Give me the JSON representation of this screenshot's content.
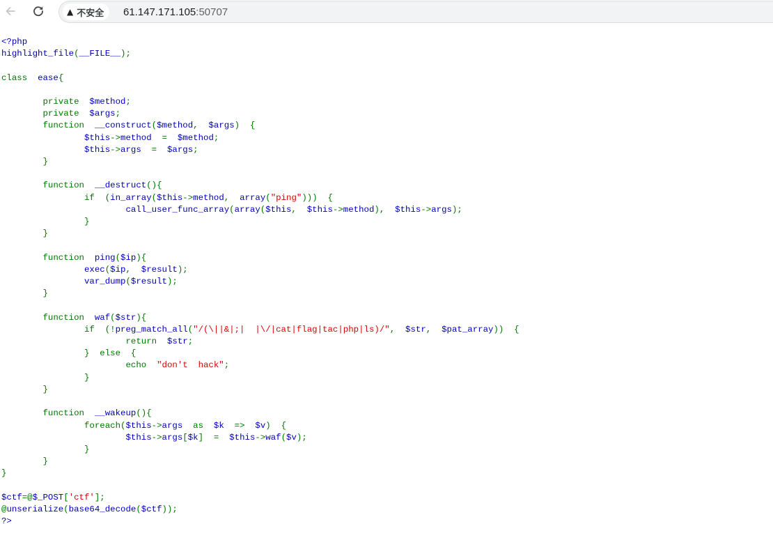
{
  "toolbar": {
    "security_label": "不安全",
    "url_host": "61.147.171.105",
    "url_port": ":50707"
  },
  "source_lines": [
    [
      [
        "d",
        "<?php"
      ]
    ],
    [
      [
        "d",
        "highlight_file"
      ],
      [
        "k",
        "("
      ],
      [
        "d",
        "__FILE__"
      ],
      [
        "k",
        ");"
      ]
    ],
    [],
    [
      [
        "k",
        "class  "
      ],
      [
        "d",
        "ease"
      ],
      [
        "k",
        "{"
      ]
    ],
    [],
    [
      [
        "k",
        "        private  "
      ],
      [
        "d",
        "$method"
      ],
      [
        "k",
        ";"
      ]
    ],
    [
      [
        "k",
        "        private  "
      ],
      [
        "d",
        "$args"
      ],
      [
        "k",
        ";"
      ]
    ],
    [
      [
        "k",
        "        function  "
      ],
      [
        "d",
        "__construct"
      ],
      [
        "k",
        "("
      ],
      [
        "d",
        "$method"
      ],
      [
        "k",
        ",  "
      ],
      [
        "d",
        "$args"
      ],
      [
        "k",
        ")  {"
      ]
    ],
    [
      [
        "d",
        "                $this"
      ],
      [
        "k",
        "->"
      ],
      [
        "d",
        "method  "
      ],
      [
        "k",
        "=  "
      ],
      [
        "d",
        "$method"
      ],
      [
        "k",
        ";"
      ]
    ],
    [
      [
        "d",
        "                $this"
      ],
      [
        "k",
        "->"
      ],
      [
        "d",
        "args  "
      ],
      [
        "k",
        "=  "
      ],
      [
        "d",
        "$args"
      ],
      [
        "k",
        ";"
      ]
    ],
    [
      [
        "k",
        "        }"
      ]
    ],
    [],
    [
      [
        "k",
        "        function  "
      ],
      [
        "d",
        "__destruct"
      ],
      [
        "k",
        "(){"
      ]
    ],
    [
      [
        "k",
        "                if  ("
      ],
      [
        "d",
        "in_array"
      ],
      [
        "k",
        "("
      ],
      [
        "d",
        "$this"
      ],
      [
        "k",
        "->"
      ],
      [
        "d",
        "method"
      ],
      [
        "k",
        ",  "
      ],
      [
        "d",
        "array"
      ],
      [
        "k",
        "("
      ],
      [
        "s",
        "\"ping\""
      ],
      [
        "k",
        ")))  {"
      ]
    ],
    [
      [
        "d",
        "                        call_user_func_array"
      ],
      [
        "k",
        "("
      ],
      [
        "d",
        "array"
      ],
      [
        "k",
        "("
      ],
      [
        "d",
        "$this"
      ],
      [
        "k",
        ",  "
      ],
      [
        "d",
        "$this"
      ],
      [
        "k",
        "->"
      ],
      [
        "d",
        "method"
      ],
      [
        "k",
        "),  "
      ],
      [
        "d",
        "$this"
      ],
      [
        "k",
        "->"
      ],
      [
        "d",
        "args"
      ],
      [
        "k",
        ");"
      ]
    ],
    [
      [
        "k",
        "                }"
      ]
    ],
    [
      [
        "k",
        "        }"
      ]
    ],
    [],
    [
      [
        "k",
        "        function  "
      ],
      [
        "d",
        "ping"
      ],
      [
        "k",
        "("
      ],
      [
        "d",
        "$ip"
      ],
      [
        "k",
        "){"
      ]
    ],
    [
      [
        "d",
        "                exec"
      ],
      [
        "k",
        "("
      ],
      [
        "d",
        "$ip"
      ],
      [
        "k",
        ",  "
      ],
      [
        "d",
        "$result"
      ],
      [
        "k",
        ");"
      ]
    ],
    [
      [
        "d",
        "                var_dump"
      ],
      [
        "k",
        "("
      ],
      [
        "d",
        "$result"
      ],
      [
        "k",
        ");"
      ]
    ],
    [
      [
        "k",
        "        }"
      ]
    ],
    [],
    [
      [
        "k",
        "        function  "
      ],
      [
        "d",
        "waf"
      ],
      [
        "k",
        "("
      ],
      [
        "d",
        "$str"
      ],
      [
        "k",
        "){"
      ]
    ],
    [
      [
        "k",
        "                if  (!"
      ],
      [
        "d",
        "preg_match_all"
      ],
      [
        "k",
        "("
      ],
      [
        "s",
        "\"/(\\||&|;|  |\\/|cat|flag|tac|php|ls)/\""
      ],
      [
        "k",
        ",  "
      ],
      [
        "d",
        "$str"
      ],
      [
        "k",
        ",  "
      ],
      [
        "d",
        "$pat_array"
      ],
      [
        "k",
        "))  {"
      ]
    ],
    [
      [
        "k",
        "                        return  "
      ],
      [
        "d",
        "$str"
      ],
      [
        "k",
        ";"
      ]
    ],
    [
      [
        "k",
        "                }  else  {"
      ]
    ],
    [
      [
        "k",
        "                        echo  "
      ],
      [
        "s",
        "\"don't  hack\""
      ],
      [
        "k",
        ";"
      ]
    ],
    [
      [
        "k",
        "                }"
      ]
    ],
    [
      [
        "k",
        "        }"
      ]
    ],
    [],
    [
      [
        "k",
        "        function  "
      ],
      [
        "d",
        "__wakeup"
      ],
      [
        "k",
        "(){"
      ]
    ],
    [
      [
        "k",
        "                foreach("
      ],
      [
        "d",
        "$this"
      ],
      [
        "k",
        "->"
      ],
      [
        "d",
        "args  "
      ],
      [
        "k",
        "as  "
      ],
      [
        "d",
        "$k  "
      ],
      [
        "k",
        "=>  "
      ],
      [
        "d",
        "$v"
      ],
      [
        "k",
        ")  {"
      ]
    ],
    [
      [
        "d",
        "                        $this"
      ],
      [
        "k",
        "->"
      ],
      [
        "d",
        "args"
      ],
      [
        "k",
        "["
      ],
      [
        "d",
        "$k"
      ],
      [
        "k",
        "]  =  "
      ],
      [
        "d",
        "$this"
      ],
      [
        "k",
        "->"
      ],
      [
        "d",
        "waf"
      ],
      [
        "k",
        "("
      ],
      [
        "d",
        "$v"
      ],
      [
        "k",
        ");"
      ]
    ],
    [
      [
        "k",
        "                }"
      ]
    ],
    [
      [
        "k",
        "        }"
      ]
    ],
    [
      [
        "k",
        "}"
      ]
    ],
    [],
    [
      [
        "d",
        "$ctf"
      ],
      [
        "k",
        "=@"
      ],
      [
        "d",
        "$_POST"
      ],
      [
        "k",
        "["
      ],
      [
        "s",
        "'ctf'"
      ],
      [
        "k",
        "];"
      ]
    ],
    [
      [
        "k",
        "@"
      ],
      [
        "d",
        "unserialize"
      ],
      [
        "k",
        "("
      ],
      [
        "d",
        "base64_decode"
      ],
      [
        "k",
        "("
      ],
      [
        "d",
        "$ctf"
      ],
      [
        "k",
        "));"
      ]
    ],
    [
      [
        "d",
        "?>"
      ]
    ]
  ]
}
